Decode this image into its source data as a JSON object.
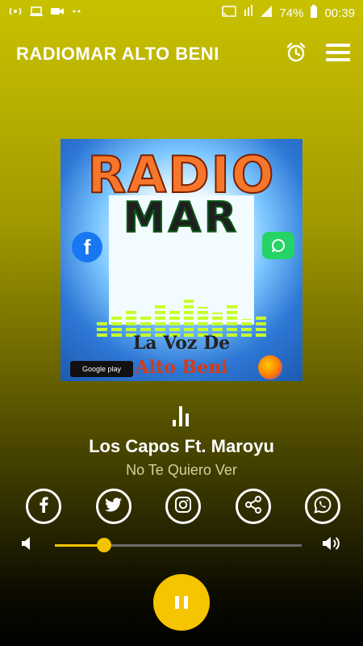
{
  "status_bar": {
    "battery": "74%",
    "time": "00:39"
  },
  "header": {
    "title": "RADIOMAR ALTO BENI"
  },
  "now_playing": {
    "artist": "Los Capos Ft. Maroyu",
    "track": "No Te Quiero Ver"
  },
  "artwork": {
    "line1": "RADIO",
    "line2": "MAR",
    "line3": "La Voz De",
    "line4": "Alto Beni",
    "store_badge": "Google play"
  },
  "social": [
    {
      "name": "facebook-icon"
    },
    {
      "name": "twitter-icon"
    },
    {
      "name": "instagram-icon"
    },
    {
      "name": "share-icon"
    },
    {
      "name": "whatsapp-icon"
    }
  ],
  "volume": {
    "level": 0.2
  },
  "colors": {
    "accent": "#f6c400",
    "top": "#c8c100",
    "bottom": "#000000"
  }
}
